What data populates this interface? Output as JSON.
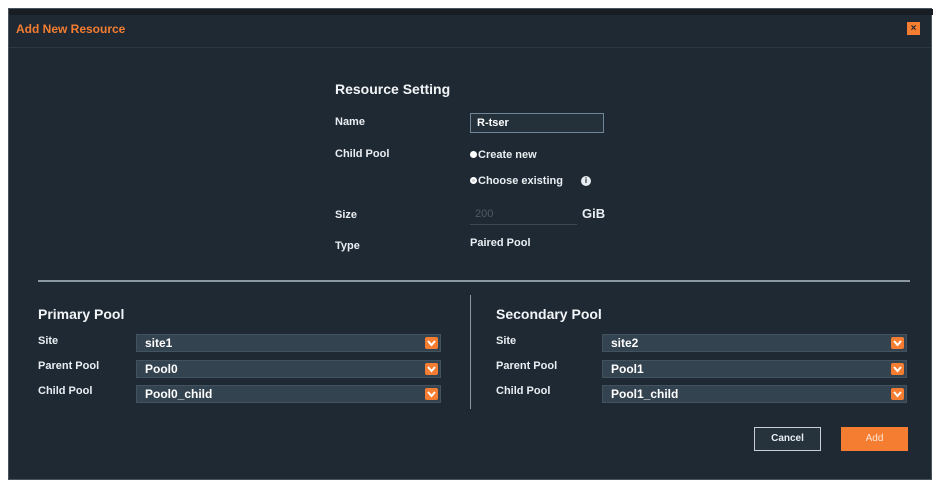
{
  "dialog": {
    "title": "Add New Resource",
    "close_icon": "close-icon",
    "accent_color": "#f47d31",
    "background_color": "#1f2933"
  },
  "resource_setting": {
    "heading": "Resource Setting",
    "name_label": "Name",
    "name_value": "R-tser",
    "child_pool_label": "Child Pool",
    "option_create_new": "Create new",
    "option_choose_existing": "Choose existing",
    "info_icon": "info-icon",
    "size_label": "Size",
    "size_placeholder": "200",
    "size_unit": "GiB",
    "type_label": "Type",
    "type_value": "Paired Pool"
  },
  "primary_pool": {
    "heading": "Primary Pool",
    "site_label": "Site",
    "site_value": "site1",
    "parent_pool_label": "Parent Pool",
    "parent_pool_value": "Pool0",
    "child_pool_label": "Child Pool",
    "child_pool_value": "Pool0_child"
  },
  "secondary_pool": {
    "heading": "Secondary Pool",
    "site_label": "Site",
    "site_value": "site2",
    "parent_pool_label": "Parent Pool",
    "parent_pool_value": "Pool1",
    "child_pool_label": "Child Pool",
    "child_pool_value": "Pool1_child"
  },
  "actions": {
    "cancel_label": "Cancel",
    "add_label": "Add"
  }
}
